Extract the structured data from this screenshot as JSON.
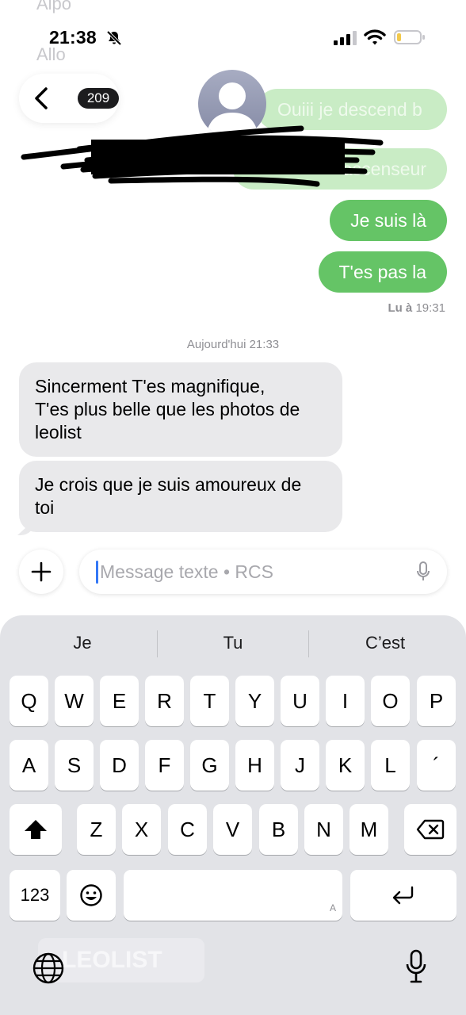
{
  "status_bar": {
    "time": "21:38"
  },
  "header": {
    "unread_count": "209"
  },
  "conversation": {
    "faded_lines": [
      "Alpo",
      "Allo"
    ],
    "outgoing_top": [
      "Ouiii je descend b",
      "ascenseur"
    ],
    "outgoing": [
      "Je suis là",
      "T'es pas la"
    ],
    "read_receipt": {
      "label": "Lu à",
      "time": "19:31"
    },
    "day_separator": "Aujourd'hui 21:33",
    "incoming": [
      {
        "lines": [
          "Sincerment T'es magnifique,",
          "T'es plus belle que les photos de",
          "leolist"
        ]
      },
      {
        "lines": [
          "Je crois que je suis amoureux de",
          "toi"
        ]
      }
    ]
  },
  "composer": {
    "placeholder": "Message texte • RCS"
  },
  "keyboard": {
    "suggestions": [
      "Je",
      "Tu",
      "C’est"
    ],
    "row1": [
      "Q",
      "W",
      "E",
      "R",
      "T",
      "Y",
      "U",
      "I",
      "O",
      "P"
    ],
    "row2": [
      "A",
      "S",
      "D",
      "F",
      "G",
      "H",
      "J",
      "K",
      "L",
      "´"
    ],
    "row3": [
      "Z",
      "X",
      "C",
      "V",
      "B",
      "N",
      "M"
    ],
    "numbers_key": "123",
    "space_hint": "A",
    "background_text": "LEOLIST"
  },
  "colors": {
    "outgoing_bubble": "#65c466",
    "incoming_bubble": "#e9e9eb",
    "caret": "#3478f6"
  },
  "icons": [
    "bell-slash-icon",
    "cellular-icon",
    "wifi-icon",
    "battery-icon",
    "chevron-left-icon",
    "person-icon",
    "plus-icon",
    "microphone-icon",
    "shift-icon",
    "backspace-icon",
    "emoji-icon",
    "return-icon",
    "globe-icon"
  ]
}
